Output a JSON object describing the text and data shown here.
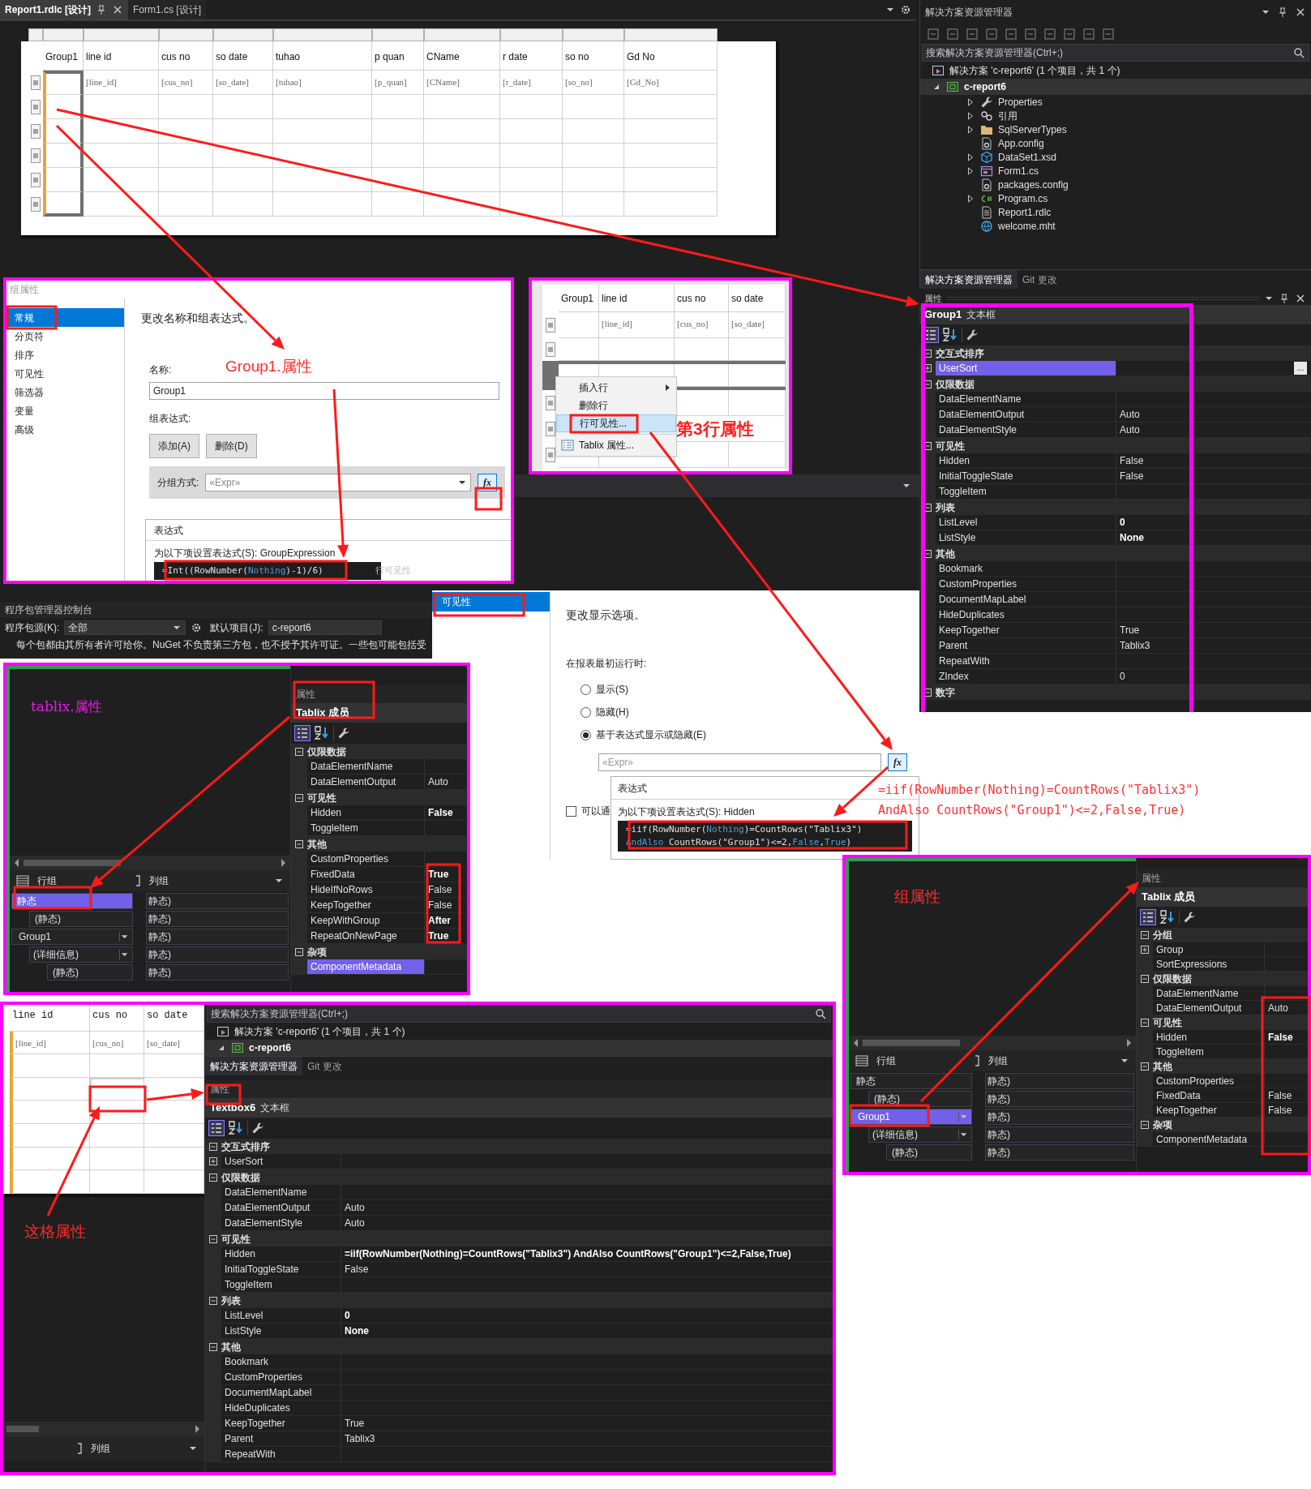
{
  "editor_tabs": [
    {
      "label": "Report1.rdlc [设计]",
      "selected": true
    },
    {
      "label": "Form1.cs [设计]",
      "selected": false
    }
  ],
  "report_table": {
    "columns": [
      "Group1",
      "line id",
      "cus no",
      "so date",
      "tuhao",
      "p quan",
      "CName",
      "r date",
      "so no",
      "Gd No"
    ],
    "fields": [
      "[line_id]",
      "[cus_no]",
      "[so_date]",
      "[tuhao]",
      "[p_quan]",
      "[CName]",
      "[r_date]",
      "[so_no]",
      "[Gd_No]"
    ]
  },
  "solution_explorer": {
    "title": "解决方案资源管理器",
    "search_placeholder": "搜索解决方案资源管理器(Ctrl+;)",
    "solution": "解决方案 'c-report6' (1 个项目，共 1 个)",
    "solution_selected": false,
    "project": "c-report6",
    "project_selected": true,
    "items": [
      {
        "label": "Properties",
        "kind": "wrench",
        "expandable": true,
        "selected": false
      },
      {
        "label": "引用",
        "kind": "references",
        "expandable": true,
        "selected": false
      },
      {
        "label": "SqlServerTypes",
        "kind": "folder",
        "expandable": true,
        "selected": false
      },
      {
        "label": "App.config",
        "kind": "config",
        "expandable": false,
        "selected": false
      },
      {
        "label": "DataSet1.xsd",
        "kind": "dataset",
        "expandable": true,
        "selected": false
      },
      {
        "label": "Form1.cs",
        "kind": "form",
        "expandable": true,
        "selected": false
      },
      {
        "label": "packages.config",
        "kind": "config",
        "expandable": false,
        "selected": false
      },
      {
        "label": "Program.cs",
        "kind": "csharp",
        "expandable": true,
        "selected": false
      },
      {
        "label": "Report1.rdlc",
        "kind": "report",
        "expandable": false,
        "selected": false
      },
      {
        "label": "welcome.mht",
        "kind": "web",
        "expandable": false,
        "selected": false
      }
    ],
    "tabs": [
      {
        "label": "解决方案资源管理器",
        "selected": true
      },
      {
        "label": "Git 更改",
        "selected": false
      }
    ]
  },
  "group_dialog": {
    "title": "组属性",
    "nav": [
      {
        "label": "常规",
        "selected": true
      },
      {
        "label": "分页符",
        "selected": false
      },
      {
        "label": "排序",
        "selected": false
      },
      {
        "label": "可见性",
        "selected": false
      },
      {
        "label": "筛选器",
        "selected": false
      },
      {
        "label": "变量",
        "selected": false
      },
      {
        "label": "高级",
        "selected": false
      }
    ],
    "heading": "更改名称和组表达式。",
    "name_label": "名称:",
    "name_value": "Group1",
    "expr_label": "组表达式:",
    "buttons": [
      "添加(A)",
      "删除(D)"
    ],
    "group_by_label": "分组方式:",
    "group_by_placeholder": "«Expr»",
    "expression_button": "fx",
    "popup": {
      "title": "表达式",
      "prompt": "为以下项设置表达式(S): GroupExpression",
      "code": [
        [
          {
            "text": "=Int((RowNumber(",
            "kind": "plain"
          },
          {
            "text": "Nothing",
            "kind": "keyword"
          },
          {
            "text": ")-1)/6)",
            "kind": "plain"
          }
        ]
      ]
    },
    "background_text": "行可见性",
    "annotation": "Group1.属性"
  },
  "context_panel": {
    "columns": [
      "Group1",
      "line id",
      "cus no",
      "so date"
    ],
    "fields": [
      "[line_id]",
      "[cus_no]",
      "[so_date]"
    ],
    "menu": [
      {
        "label": "插入行",
        "kind": "submenu",
        "selected": false
      },
      {
        "label": "删除行",
        "kind": "plain",
        "selected": false
      },
      {
        "label": "行可见性...",
        "kind": "plain",
        "selected": true
      },
      {
        "label": "Tablix 属性...",
        "kind": "icon",
        "selected": false
      }
    ],
    "annotation": "第3行属性"
  },
  "properties": {
    "header": "属性",
    "object": "Group1",
    "object_type": "文本框",
    "ellipsis_button": "...",
    "groups": [
      {
        "title": "交互式排序",
        "rows": [
          {
            "name": "UserSort",
            "selected": true,
            "expandable": true
          }
        ]
      },
      {
        "title": "仅限数据",
        "rows": [
          {
            "name": "DataElementName",
            "selected": false,
            "expandable": false
          },
          {
            "name": "DataElementOutput",
            "value": "Auto",
            "bold": false,
            "selected": false,
            "expandable": false
          },
          {
            "name": "DataElementStyle",
            "value": "Auto",
            "bold": false,
            "selected": false,
            "expandable": false
          }
        ]
      },
      {
        "title": "可见性",
        "rows": [
          {
            "name": "Hidden",
            "value": "False",
            "bold": false,
            "selected": false,
            "expandable": false
          },
          {
            "name": "InitialToggleState",
            "value": "False",
            "bold": false,
            "selected": false,
            "expandable": false
          },
          {
            "name": "ToggleItem",
            "selected": false,
            "expandable": false
          }
        ]
      },
      {
        "title": "列表",
        "rows": [
          {
            "name": "ListLevel",
            "value": "0",
            "bold": true,
            "selected": false,
            "expandable": false
          },
          {
            "name": "ListStyle",
            "value": "None",
            "bold": true,
            "selected": false,
            "expandable": false
          }
        ]
      },
      {
        "title": "其他",
        "rows": [
          {
            "name": "Bookmark",
            "selected": false,
            "expandable": false
          },
          {
            "name": "CustomProperties",
            "selected": false,
            "expandable": false
          },
          {
            "name": "DocumentMapLabel",
            "selected": false,
            "expandable": false
          },
          {
            "name": "HideDuplicates",
            "selected": false,
            "expandable": false
          },
          {
            "name": "KeepTogether",
            "value": "True",
            "bold": false,
            "selected": false,
            "expandable": false
          },
          {
            "name": "Parent",
            "value": "Tablix3",
            "bold": false,
            "selected": false,
            "expandable": false
          },
          {
            "name": "RepeatWith",
            "selected": false,
            "expandable": false
          },
          {
            "name": "ZIndex",
            "value": "0",
            "bold": false,
            "selected": false,
            "expandable": false
          }
        ]
      },
      {
        "title": "数字"
      }
    ]
  },
  "package_console": {
    "title": "程序包管理器控制台",
    "source_label": "程序包源(K):",
    "source_value": "全部",
    "project_label": "默认项目(J):",
    "project_value": "c-report6",
    "notice": "每个包都由其所有者许可给你。NuGet 不负责第三方包，也不授予其许可证。一些包可能包括受"
  },
  "visibility_dialog": {
    "nav": [
      {
        "label": "可见性",
        "selected": true
      }
    ],
    "heading": "更改显示选项。",
    "prompt": "在报表最初运行时:",
    "options": [
      {
        "label": "显示(S)",
        "selected": false
      },
      {
        "label": "隐藏(H)",
        "selected": false
      },
      {
        "label": "基于表达式显示或隐藏(E)",
        "selected": true
      }
    ],
    "expr_placeholder": "«Expr»",
    "expression_button": "fx",
    "checkbox": {
      "label": "可以通",
      "checked": false
    },
    "popup": {
      "title": "表达式",
      "prompt": "为以下项设置表达式(S): Hidden",
      "code": [
        [
          {
            "text": "=iif(RowNumber(",
            "kind": "plain"
          },
          {
            "text": "Nothing",
            "kind": "keyword"
          },
          {
            "text": ")=CountRows(\"Tablix3\")",
            "kind": "plain"
          }
        ],
        [
          {
            "text": "AndAlso",
            "kind": "keyword"
          },
          {
            "text": " CountRows(\"Group1\")<=2,",
            "kind": "plain"
          },
          {
            "text": "False",
            "kind": "keyword"
          },
          {
            "text": ",",
            "kind": "plain"
          },
          {
            "text": "True",
            "kind": "keyword"
          },
          {
            "text": ")",
            "kind": "plain"
          }
        ]
      ]
    }
  },
  "expression_annotation": [
    "=iif(RowNumber(Nothing)=CountRows(\"Tablix3\")",
    "AndAlso CountRows(\"Group1\")<=2,False,True)"
  ],
  "tablix_panel": {
    "annotation": "tablix.属性",
    "row_groups_label": "行组",
    "column_groups_label": "列组",
    "row_groups": [
      {
        "label": "静态",
        "kind": "static",
        "selected": true,
        "children": [
          {
            "label": "(静态)",
            "kind": "static",
            "selected": false
          }
        ]
      },
      {
        "label": "Group1",
        "kind": "group",
        "selected": false,
        "children": [
          {
            "label": "(详细信息)",
            "kind": "details",
            "selected": false,
            "children": [
              {
                "label": "(静态)",
                "kind": "static",
                "selected": false
              }
            ]
          }
        ]
      }
    ],
    "column_groups": [
      "静态)",
      "静态)",
      "静态)",
      "静态)",
      "静态)"
    ],
    "properties": {
      "header": "属性",
      "object": "Tablix 成员",
      "groups": [
        {
          "title": "仅限数据",
          "rows": [
            {
              "name": "DataElementName",
              "selected": false,
              "expandable": false
            },
            {
              "name": "DataElementOutput",
              "value": "Auto",
              "bold": false,
              "selected": false,
              "expandable": false
            }
          ]
        },
        {
          "title": "可见性",
          "rows": [
            {
              "name": "Hidden",
              "value": "False",
              "bold": true,
              "selected": false,
              "expandable": false
            },
            {
              "name": "ToggleItem",
              "selected": false,
              "expandable": false
            }
          ]
        },
        {
          "title": "其他",
          "rows": [
            {
              "name": "CustomProperties",
              "selected": false,
              "expandable": false
            },
            {
              "name": "FixedData",
              "value": "True",
              "bold": true,
              "selected": false,
              "expandable": false
            },
            {
              "name": "HideIfNoRows",
              "value": "False",
              "bold": false,
              "selected": false,
              "expandable": false
            },
            {
              "name": "KeepTogether",
              "value": "False",
              "bold": false,
              "selected": false,
              "expandable": false
            },
            {
              "name": "KeepWithGroup",
              "value": "After",
              "bold": true,
              "selected": false,
              "expandable": false
            },
            {
              "name": "RepeatOnNewPage",
              "value": "True",
              "bold": true,
              "selected": false,
              "expandable": false
            }
          ]
        },
        {
          "title": "杂项",
          "rows": [
            {
              "name": "ComponentMetadata",
              "selected": true,
              "expandable": false
            }
          ]
        }
      ]
    }
  },
  "group_panel": {
    "annotation": "组属性",
    "row_groups_label": "行组",
    "column_groups_label": "列组",
    "row_groups": [
      {
        "label": "静态",
        "kind": "static",
        "selected": false,
        "children": [
          {
            "label": "(静态)",
            "kind": "static",
            "selected": false
          }
        ]
      },
      {
        "label": "Group1",
        "kind": "group",
        "selected": true,
        "children": [
          {
            "label": "(详细信息)",
            "kind": "details",
            "selected": false,
            "children": [
              {
                "label": "(静态)",
                "kind": "static",
                "selected": false
              }
            ]
          }
        ]
      }
    ],
    "column_groups": [
      "静态)",
      "静态)",
      "静态)",
      "静态)",
      "静态)"
    ],
    "properties": {
      "header": "属性",
      "object": "Tablix 成员",
      "groups": [
        {
          "title": "分组",
          "rows": [
            {
              "name": "Group",
              "selected": false,
              "expandable": true
            },
            {
              "name": "SortExpressions",
              "selected": false,
              "expandable": false
            }
          ]
        },
        {
          "title": "仅限数据",
          "rows": [
            {
              "name": "DataElementName",
              "selected": false,
              "expandable": false
            },
            {
              "name": "DataElementOutput",
              "value": "Auto",
              "bold": false,
              "selected": false,
              "expandable": false
            }
          ]
        },
        {
          "title": "可见性",
          "rows": [
            {
              "name": "Hidden",
              "value": "False",
              "bold": true,
              "selected": false,
              "expandable": false
            },
            {
              "name": "ToggleItem",
              "selected": false,
              "expandable": false
            }
          ]
        },
        {
          "title": "其他",
          "rows": [
            {
              "name": "CustomProperties",
              "selected": false,
              "expandable": false
            },
            {
              "name": "FixedData",
              "value": "False",
              "bold": false,
              "selected": false,
              "expandable": false
            },
            {
              "name": "KeepTogether",
              "value": "False",
              "bold": false,
              "selected": false,
              "expandable": false
            }
          ]
        },
        {
          "title": "杂项",
          "rows": [
            {
              "name": "ComponentMetadata",
              "selected": false,
              "expandable": false
            }
          ]
        }
      ]
    }
  },
  "bottom_panel": {
    "columns": [
      "line id",
      "cus no",
      "so date"
    ],
    "fields": [
      "[line_id]",
      "[cus_no]",
      "[so_date]"
    ],
    "annotation": "这格属性",
    "column_groups_label": "列组",
    "search_placeholder": "搜索解决方案资源管理器(Ctrl+;)",
    "solution": "解决方案 'c-report6' (1 个项目，共 1 个)",
    "solution_selected": false,
    "project": "c-report6",
    "project_selected": true,
    "tabs": [
      {
        "label": "解决方案资源管理器",
        "selected": true
      },
      {
        "label": "Git 更改",
        "selected": false
      }
    ],
    "properties": {
      "header": "属性",
      "object": "Textbox6",
      "object_type": "文本框",
      "groups": [
        {
          "title": "交互式排序",
          "rows": [
            {
              "name": "UserSort",
              "selected": false,
              "expandable": true
            }
          ]
        },
        {
          "title": "仅限数据",
          "rows": [
            {
              "name": "DataElementName",
              "selected": false,
              "expandable": false
            },
            {
              "name": "DataElementOutput",
              "value": "Auto",
              "bold": false,
              "selected": false,
              "expandable": false
            },
            {
              "name": "DataElementStyle",
              "value": "Auto",
              "bold": false,
              "selected": false,
              "expandable": false
            }
          ]
        },
        {
          "title": "可见性",
          "rows": [
            {
              "name": "Hidden",
              "value": "=iif(RowNumber(Nothing)=CountRows(\"Tablix3\") AndAlso CountRows(\"Group1\")<=2,False,True)",
              "bold": true,
              "selected": false,
              "expandable": false
            },
            {
              "name": "InitialToggleState",
              "value": "False",
              "bold": false,
              "selected": false,
              "expandable": false
            },
            {
              "name": "ToggleItem",
              "selected": false,
              "expandable": false
            }
          ]
        },
        {
          "title": "列表",
          "rows": [
            {
              "name": "ListLevel",
              "value": "0",
              "bold": true,
              "selected": false,
              "expandable": false
            },
            {
              "name": "ListStyle",
              "value": "None",
              "bold": true,
              "selected": false,
              "expandable": false
            }
          ]
        },
        {
          "title": "其他",
          "rows": [
            {
              "name": "Bookmark",
              "selected": false,
              "expandable": false
            },
            {
              "name": "CustomProperties",
              "selected": false,
              "expandable": false
            },
            {
              "name": "DocumentMapLabel",
              "selected": false,
              "expandable": false
            },
            {
              "name": "HideDuplicates",
              "selected": false,
              "expandable": false
            },
            {
              "name": "KeepTogether",
              "value": "True",
              "bold": false,
              "selected": false,
              "expandable": false
            },
            {
              "name": "Parent",
              "value": "Tablix3",
              "bold": false,
              "selected": false,
              "expandable": false
            },
            {
              "name": "RepeatWith",
              "selected": false,
              "expandable": false
            }
          ]
        }
      ]
    }
  }
}
